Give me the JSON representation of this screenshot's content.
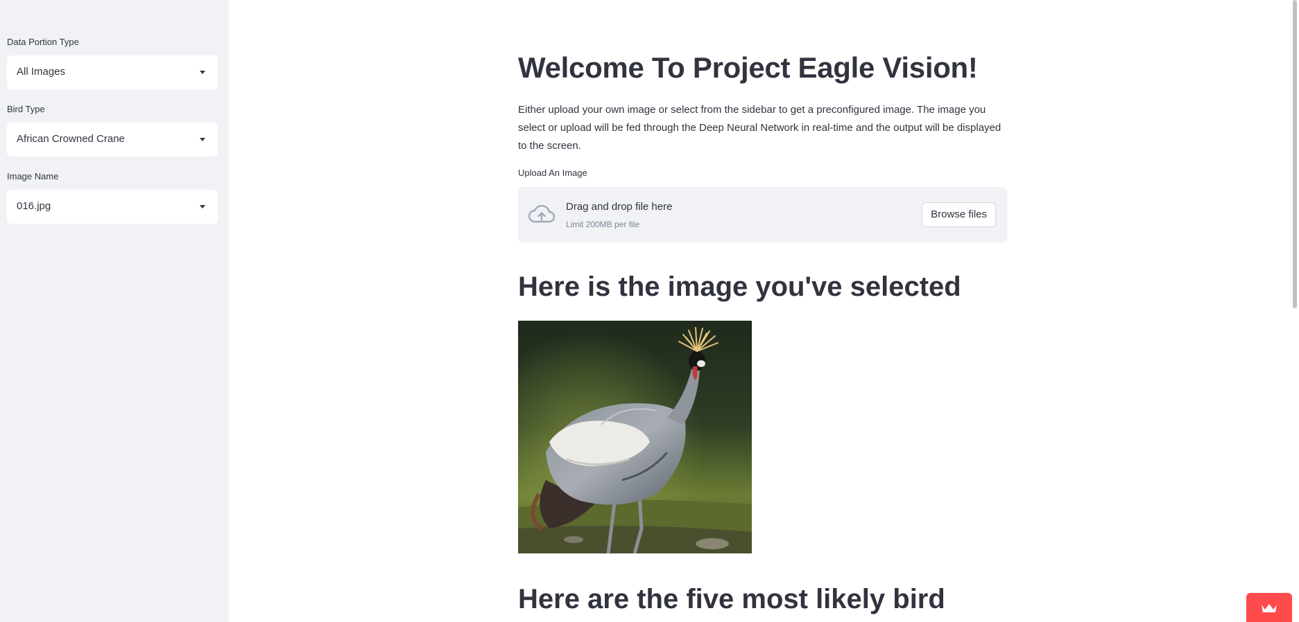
{
  "sidebar": {
    "data_portion": {
      "label": "Data Portion Type",
      "value": "All Images"
    },
    "bird_type": {
      "label": "Bird Type",
      "value": "African Crowned Crane"
    },
    "image_name": {
      "label": "Image Name",
      "value": "016.jpg"
    }
  },
  "main": {
    "title": "Welcome To Project Eagle Vision!",
    "intro": "Either upload your own image or select from the sidebar to get a preconfigured image. The image you select or upload will be fed through the Deep Neural Network in real-time and the output will be displayed to the screen.",
    "uploader": {
      "label": "Upload An Image",
      "drop_text": "Drag and drop file here",
      "limit_text": "Limit 200MB per file",
      "browse_label": "Browse files"
    },
    "selected_heading": "Here is the image you've selected",
    "predictions_heading": "Here are the five most likely bird"
  },
  "colors": {
    "sidebar_bg": "#f0f2f6",
    "text": "#31333f",
    "accent": "#ff4b4b"
  },
  "icons": {
    "upload": "cloud-upload-icon",
    "select_caret": "chevron-down-icon",
    "badge": "crown-icon"
  }
}
